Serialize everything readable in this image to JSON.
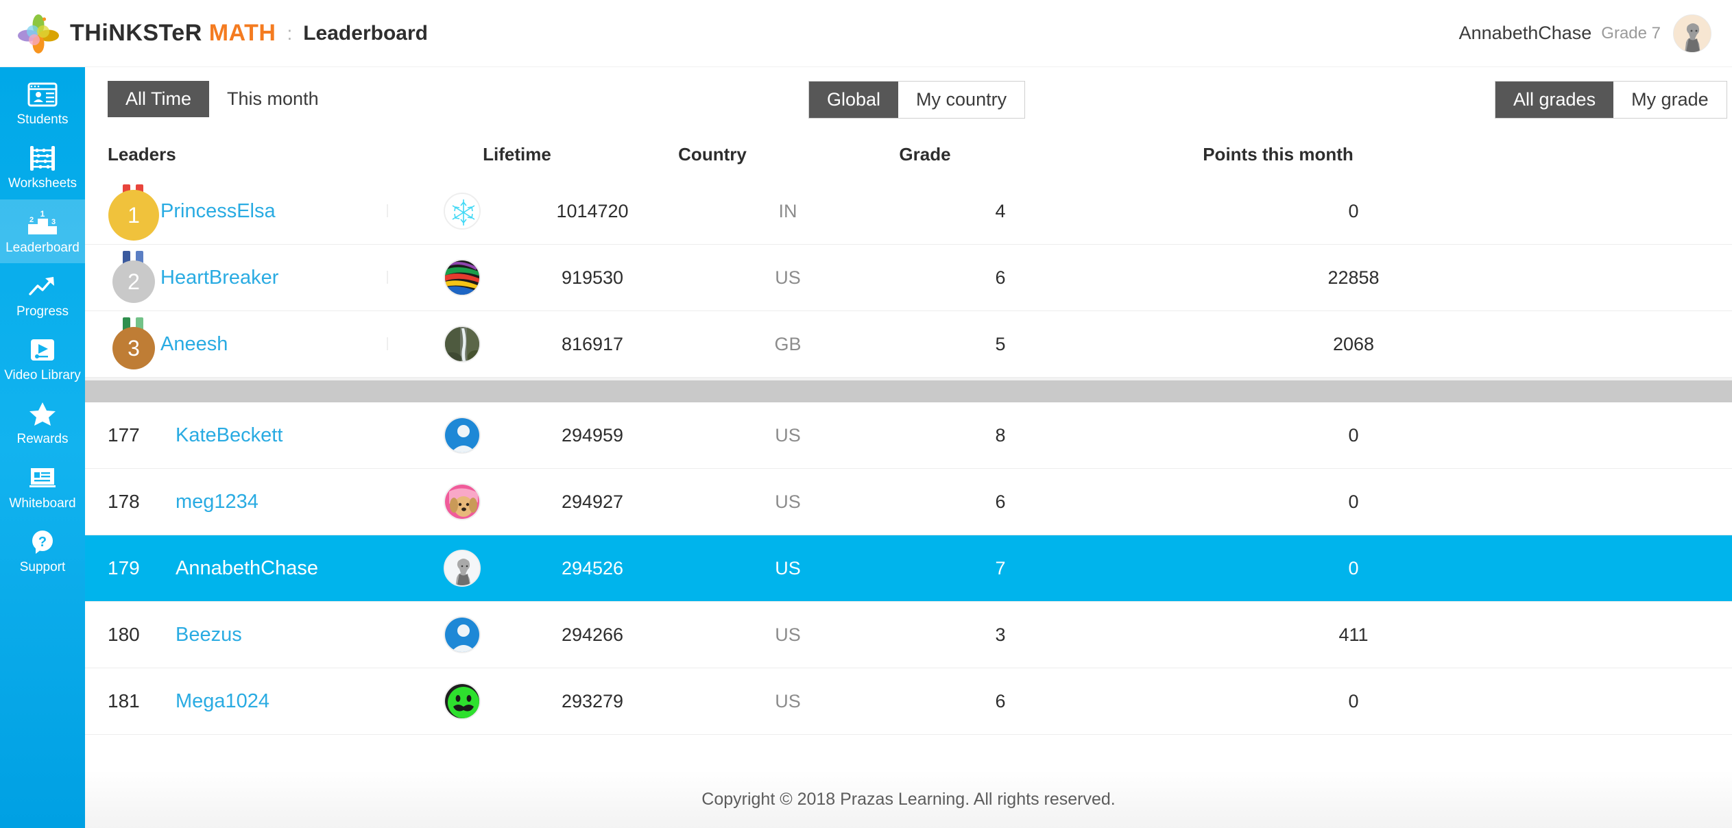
{
  "brand": {
    "thinkster": "THiNKSTeR",
    "math": "MATH",
    "separator": ":",
    "page_title": "Leaderboard"
  },
  "user": {
    "name": "AnnabethChase",
    "grade": "Grade 7",
    "avatar_icon": "girl-cartoon-avatar"
  },
  "sidebar": {
    "items": [
      {
        "label": "Students",
        "icon": "id-card-icon",
        "active": false
      },
      {
        "label": "Worksheets",
        "icon": "abacus-icon",
        "active": false
      },
      {
        "label": "Leaderboard",
        "icon": "podium-icon",
        "active": true
      },
      {
        "label": "Progress",
        "icon": "trend-up-icon",
        "active": false
      },
      {
        "label": "Video Library",
        "icon": "video-play-icon",
        "active": false
      },
      {
        "label": "Rewards",
        "icon": "star-icon",
        "active": false
      },
      {
        "label": "Whiteboard",
        "icon": "whiteboard-icon",
        "active": false
      },
      {
        "label": "Support",
        "icon": "question-bubble-icon",
        "active": false
      }
    ]
  },
  "filters": {
    "time": {
      "options": [
        "All Time",
        "This month"
      ],
      "selected": "All Time"
    },
    "scope": {
      "options": [
        "Global",
        "My country"
      ],
      "selected": "Global"
    },
    "grade": {
      "options": [
        "All grades",
        "My grade"
      ],
      "selected": "All grades"
    }
  },
  "table": {
    "headers": {
      "leaders": "Leaders",
      "lifetime": "Lifetime",
      "country": "Country",
      "grade": "Grade",
      "points": "Points this month"
    },
    "top": [
      {
        "rank": "1",
        "medal": "gold",
        "name": "PrincessElsa",
        "lifetime": "1014720",
        "country": "IN",
        "grade": "4",
        "points": "0",
        "avatar_icon": "snowflake-avatar"
      },
      {
        "rank": "2",
        "medal": "silver",
        "name": "HeartBreaker",
        "lifetime": "919530",
        "country": "US",
        "grade": "6",
        "points": "22858",
        "avatar_icon": "rainbow-avatar"
      },
      {
        "rank": "3",
        "medal": "bronze",
        "name": "Aneesh",
        "lifetime": "816917",
        "country": "GB",
        "grade": "5",
        "points": "2068",
        "avatar_icon": "waterfall-avatar"
      }
    ],
    "rows": [
      {
        "rank": "177",
        "name": "KateBeckett",
        "lifetime": "294959",
        "country": "US",
        "grade": "8",
        "points": "0",
        "avatar_icon": "default-person-avatar",
        "highlight": false
      },
      {
        "rank": "178",
        "name": "meg1234",
        "lifetime": "294927",
        "country": "US",
        "grade": "6",
        "points": "0",
        "avatar_icon": "puppy-avatar",
        "highlight": false
      },
      {
        "rank": "179",
        "name": "AnnabethChase",
        "lifetime": "294526",
        "country": "US",
        "grade": "7",
        "points": "0",
        "avatar_icon": "girl-cartoon-avatar",
        "highlight": true
      },
      {
        "rank": "180",
        "name": "Beezus",
        "lifetime": "294266",
        "country": "US",
        "grade": "3",
        "points": "411",
        "avatar_icon": "default-person-avatar",
        "highlight": false
      },
      {
        "rank": "181",
        "name": "Mega1024",
        "lifetime": "293279",
        "country": "US",
        "grade": "6",
        "points": "0",
        "avatar_icon": "green-mustache-avatar",
        "highlight": false
      }
    ]
  },
  "footer": {
    "copyright": "Copyright © 2018 Prazas Learning. All rights reserved."
  },
  "colors": {
    "sidebar_blue": "#00a8e8",
    "link_blue": "#29abe2",
    "highlight_row": "#00b4ec",
    "brand_orange": "#f47b20",
    "segment_active": "#575757",
    "gold": "#f0c23c",
    "silver": "#c9c9c9",
    "bronze": "#bf7d35"
  }
}
